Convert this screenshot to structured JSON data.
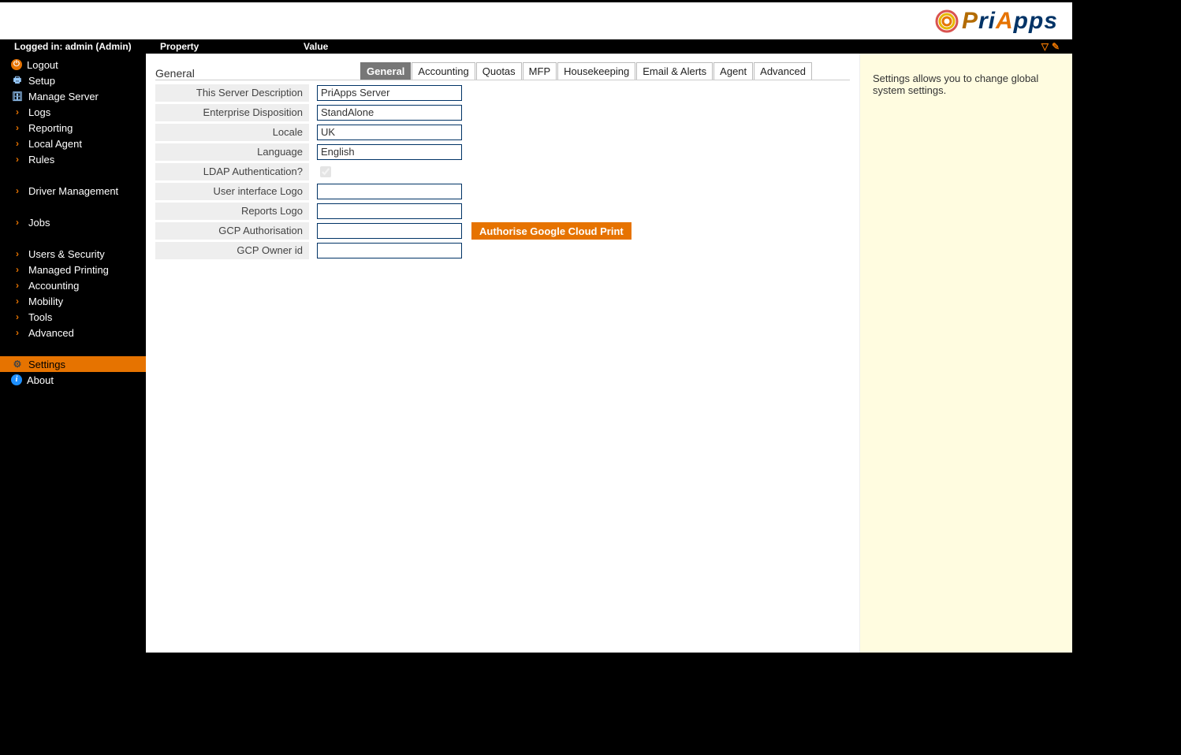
{
  "brand": {
    "text_parts": [
      "P",
      "ri",
      "A",
      "pps"
    ]
  },
  "midbar": {
    "logged_in": "Logged in: admin (Admin)",
    "col_property": "Property",
    "col_value": "Value"
  },
  "sidebar": {
    "items": [
      {
        "id": "logout",
        "label": "Logout",
        "icon": "power"
      },
      {
        "id": "setup",
        "label": "Setup",
        "icon": "setup"
      },
      {
        "id": "manage",
        "label": "Manage Server",
        "icon": "manage"
      },
      {
        "id": "logs",
        "label": "Logs",
        "icon": "chev"
      },
      {
        "id": "report",
        "label": "Reporting",
        "icon": "chev"
      },
      {
        "id": "localagent",
        "label": "Local Agent",
        "icon": "chev"
      },
      {
        "id": "rules",
        "label": "Rules",
        "icon": "chev"
      },
      {
        "id": "gap1",
        "gap": true
      },
      {
        "id": "driver",
        "label": "Driver Management",
        "icon": "chev"
      },
      {
        "id": "gap2",
        "gap": true
      },
      {
        "id": "jobs",
        "label": "Jobs",
        "icon": "chev"
      },
      {
        "id": "gap3",
        "gap": true
      },
      {
        "id": "usersec",
        "label": "Users & Security",
        "icon": "chev"
      },
      {
        "id": "mprint",
        "label": "Managed Printing",
        "icon": "chev"
      },
      {
        "id": "acct",
        "label": "Accounting",
        "icon": "chev"
      },
      {
        "id": "mobility",
        "label": "Mobility",
        "icon": "chev"
      },
      {
        "id": "tools",
        "label": "Tools",
        "icon": "chev"
      },
      {
        "id": "advanced",
        "label": "Advanced",
        "icon": "chev"
      },
      {
        "id": "gap4",
        "gap": true
      },
      {
        "id": "settings",
        "label": "Settings",
        "icon": "gear",
        "selected": true
      },
      {
        "id": "about",
        "label": "About",
        "icon": "info"
      }
    ]
  },
  "tabs": {
    "section_title": "General",
    "items": [
      {
        "id": "general",
        "label": "General",
        "active": true
      },
      {
        "id": "accounting",
        "label": "Accounting"
      },
      {
        "id": "quotas",
        "label": "Quotas"
      },
      {
        "id": "mfp",
        "label": "MFP"
      },
      {
        "id": "housekeeping",
        "label": "Housekeeping"
      },
      {
        "id": "emailalerts",
        "label": "Email & Alerts"
      },
      {
        "id": "agent",
        "label": "Agent"
      },
      {
        "id": "advanced",
        "label": "Advanced"
      }
    ]
  },
  "form": {
    "rows": [
      {
        "id": "desc",
        "label": "This Server Description",
        "type": "text",
        "value": "PriApps Server"
      },
      {
        "id": "entdisp",
        "label": "Enterprise Disposition",
        "type": "text",
        "value": "StandAlone"
      },
      {
        "id": "locale",
        "label": "Locale",
        "type": "text",
        "value": "UK"
      },
      {
        "id": "lang",
        "label": "Language",
        "type": "text",
        "value": "English"
      },
      {
        "id": "ldap",
        "label": "LDAP Authentication?",
        "type": "checkbox",
        "checked": true,
        "disabled": true
      },
      {
        "id": "uilogo",
        "label": "User interface Logo",
        "type": "text",
        "value": ""
      },
      {
        "id": "replogo",
        "label": "Reports Logo",
        "type": "text",
        "value": ""
      },
      {
        "id": "gcpauth",
        "label": "GCP Authorisation",
        "type": "text",
        "value": "",
        "button": "Authorise Google Cloud Print"
      },
      {
        "id": "gcpowner",
        "label": "GCP Owner id",
        "type": "text",
        "value": ""
      }
    ]
  },
  "help": {
    "text": "Settings allows you to change global system settings."
  }
}
